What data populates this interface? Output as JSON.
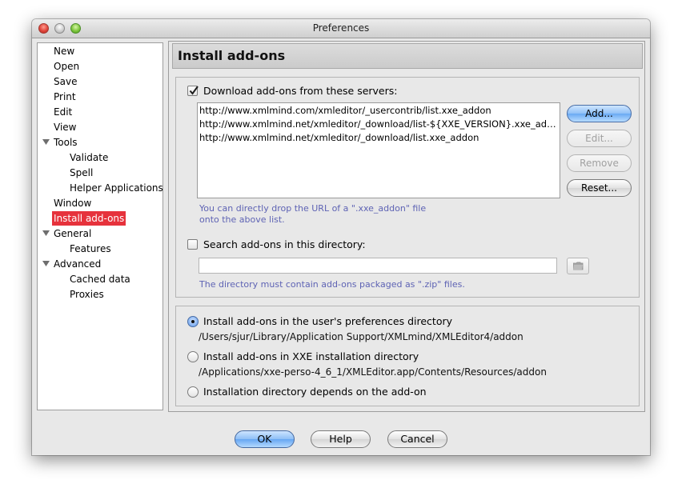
{
  "window": {
    "title": "Preferences"
  },
  "nav": {
    "items": [
      {
        "label": "New"
      },
      {
        "label": "Open"
      },
      {
        "label": "Save"
      },
      {
        "label": "Print"
      },
      {
        "label": "Edit"
      },
      {
        "label": "View"
      },
      {
        "label": "Tools"
      },
      {
        "label": "Validate"
      },
      {
        "label": "Spell"
      },
      {
        "label": "Helper Applications"
      },
      {
        "label": "Window"
      },
      {
        "label": "Install add-ons"
      },
      {
        "label": "General"
      },
      {
        "label": "Features"
      },
      {
        "label": "Advanced"
      },
      {
        "label": "Cached data"
      },
      {
        "label": "Proxies"
      }
    ],
    "selected": "Install add-ons"
  },
  "panel": {
    "title": "Install add-ons",
    "servers": {
      "checkbox_label": "Download add-ons from these servers:",
      "checked": true,
      "list": [
        "http://www.xmlmind.com/xmleditor/_usercontrib/list.xxe_addon",
        "http://www.xmlmind.net/xmleditor/_download/list-${XXE_VERSION}.xxe_addon",
        "http://www.xmlmind.net/xmleditor/_download/list.xxe_addon"
      ],
      "buttons": {
        "add": "Add...",
        "edit": "Edit...",
        "remove": "Remove",
        "reset": "Reset..."
      },
      "hint_line1": "You can directly drop the URL of a \".xxe_addon\" file",
      "hint_line2": "onto the above list."
    },
    "directory": {
      "checkbox_label": "Search add-ons in this directory:",
      "checked": false,
      "value": "",
      "hint": "The directory must contain add-ons packaged as \".zip\" files."
    },
    "install_options": [
      {
        "label": "Install add-ons in the user's preferences directory",
        "path": "/Users/sjur/Library/Application Support/XMLmind/XMLEditor4/addon",
        "selected": true
      },
      {
        "label": "Install add-ons in XXE installation directory",
        "path": "/Applications/xxe-perso-4_6_1/XMLEditor.app/Contents/Resources/addon",
        "selected": false
      },
      {
        "label": "Installation directory depends on the add-on",
        "path": "",
        "selected": false
      }
    ]
  },
  "dialog": {
    "ok": "OK",
    "help": "Help",
    "cancel": "Cancel"
  },
  "colors": {
    "selection": "#e6323c",
    "hint_text": "#5e63b4",
    "default_button": "#6aa9f3"
  }
}
